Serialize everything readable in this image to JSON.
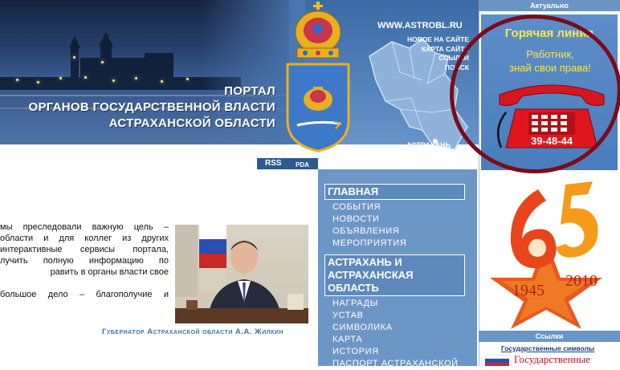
{
  "header": {
    "title_lines": [
      "ПОРТАЛ",
      "ОРГАНОВ ГОСУДАРСТВЕННОЙ ВЛАСТИ",
      "АСТРАХАНСКОЙ ОБЛАСТИ"
    ],
    "site_url": "WWW.ASTROBL.RU",
    "links": [
      "НОВОЕ НА САЙТЕ",
      "КАРТА САЙТА",
      "ССЫЛКИ",
      "ПОИСК"
    ],
    "map_label": "АСТРАХАНЬ"
  },
  "toolbar": {
    "rss": "RSS",
    "pda": "PDA"
  },
  "intro": {
    "lines": [
      "мы преследовали важную цель –",
      "области и для коллег из других",
      "интерактивные сервисы портала,",
      "лучить полную информацию по",
      "равить в органы власти свое",
      "большое дело – благополучие и"
    ],
    "caption": "Губернатор Астраханской области А.А. Жилкин"
  },
  "nav": {
    "sections": [
      {
        "title": "ГЛАВНАЯ",
        "items": [
          "СОБЫТИЯ",
          "НОВОСТИ",
          "ОБЪЯВЛЕНИЯ",
          "МЕРОПРИЯТИЯ"
        ]
      },
      {
        "title": "АСТРАХАНЬ И АСТРАХАНСКАЯ ОБЛАСТЬ",
        "items": [
          "НАГРАДЫ",
          "УСТАВ",
          "СИМВОЛИКА",
          "КАРТА",
          "ИСТОРИЯ",
          "ПАСПОРТ АСТРАХАНСКОЙ"
        ]
      }
    ]
  },
  "right": {
    "aktualno": "Актуально",
    "hotline_title": "Горячая линия",
    "hotline_line1": "Работник,",
    "hotline_line2": "знай свои права!",
    "hotline_phone": "39-48-44",
    "victory_year_start": "1945",
    "victory_year_end": "2010",
    "links_header": "Ссылки",
    "symbols_title": "Государственные символы",
    "symbols_banner": "Государственные"
  },
  "colors": {
    "nav_bg": "#6c96c6",
    "header_bg": "#4f7fb8",
    "hotline_text": "#f7e84a",
    "caption": "#3c6fa8"
  }
}
